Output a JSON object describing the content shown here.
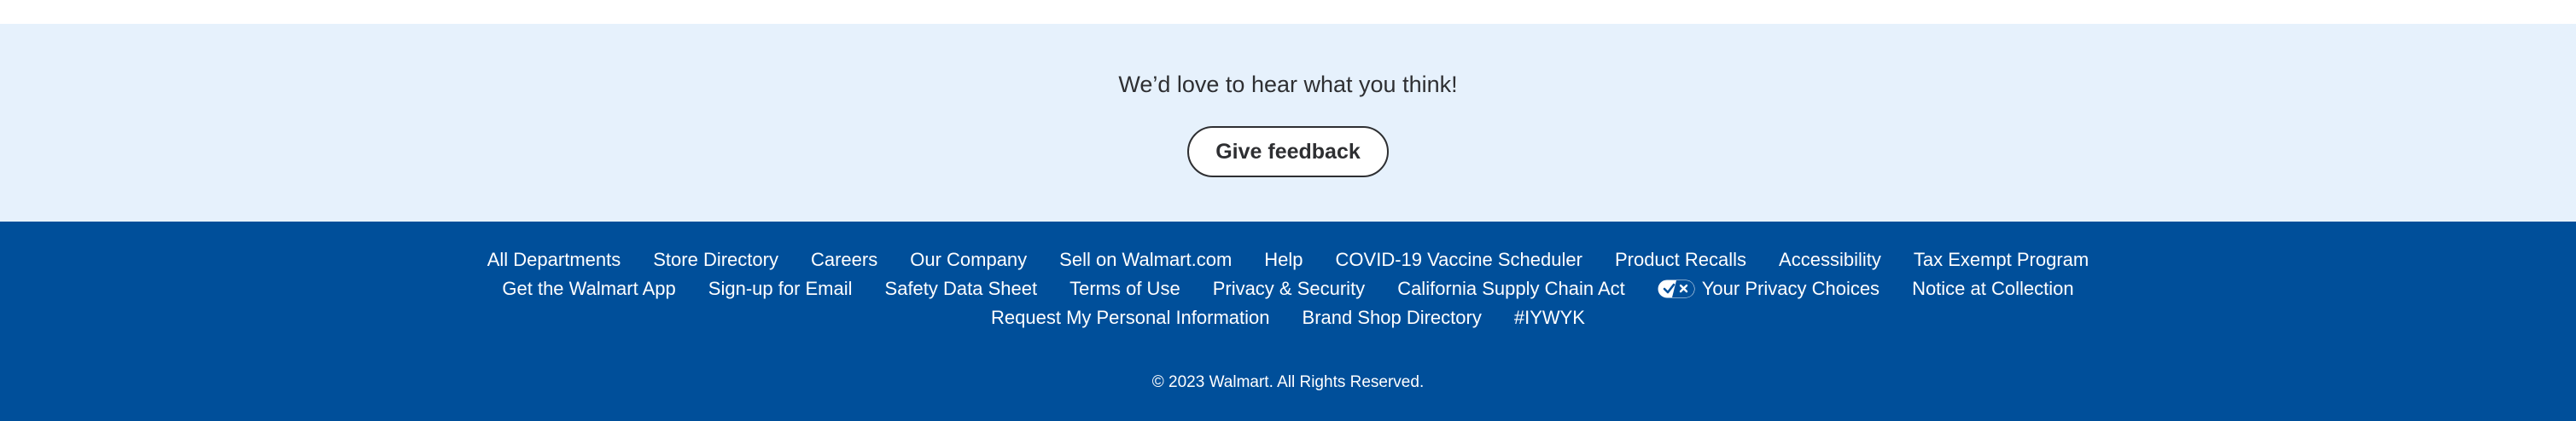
{
  "feedback": {
    "prompt": "We’d love to hear what you think!",
    "button_label": "Give feedback"
  },
  "footer": {
    "rows": [
      [
        {
          "id": "all-departments",
          "label": "All Departments"
        },
        {
          "id": "store-directory",
          "label": "Store Directory"
        },
        {
          "id": "careers",
          "label": "Careers"
        },
        {
          "id": "our-company",
          "label": "Our Company"
        },
        {
          "id": "sell-on-walmart",
          "label": "Sell on Walmart.com"
        },
        {
          "id": "help",
          "label": "Help"
        },
        {
          "id": "covid-vaccine-scheduler",
          "label": "COVID-19 Vaccine Scheduler"
        },
        {
          "id": "product-recalls",
          "label": "Product Recalls"
        },
        {
          "id": "accessibility",
          "label": "Accessibility"
        },
        {
          "id": "tax-exempt-program",
          "label": "Tax Exempt Program"
        }
      ],
      [
        {
          "id": "get-walmart-app",
          "label": "Get the Walmart App"
        },
        {
          "id": "sign-up-email",
          "label": "Sign-up for Email"
        },
        {
          "id": "safety-data-sheet",
          "label": "Safety Data Sheet"
        },
        {
          "id": "terms-of-use",
          "label": "Terms of Use"
        },
        {
          "id": "privacy-security",
          "label": "Privacy & Security"
        },
        {
          "id": "california-supply-chain-act",
          "label": "California Supply Chain Act"
        },
        {
          "id": "your-privacy-choices",
          "label": "Your Privacy Choices",
          "icon": "privacy-choices-toggle-icon"
        },
        {
          "id": "notice-at-collection",
          "label": "Notice at Collection"
        }
      ],
      [
        {
          "id": "request-personal-information",
          "label": "Request My Personal Information"
        },
        {
          "id": "brand-shop-directory",
          "label": "Brand Shop Directory"
        },
        {
          "id": "iywyk",
          "label": "#IYWYK"
        }
      ]
    ],
    "copyright": "© 2023 Walmart. All Rights Reserved."
  },
  "colors": {
    "feedback_background": "#e6f1fc",
    "footer_background": "#004f9a",
    "text_dark": "#2e2f32",
    "text_light": "#ffffff"
  }
}
